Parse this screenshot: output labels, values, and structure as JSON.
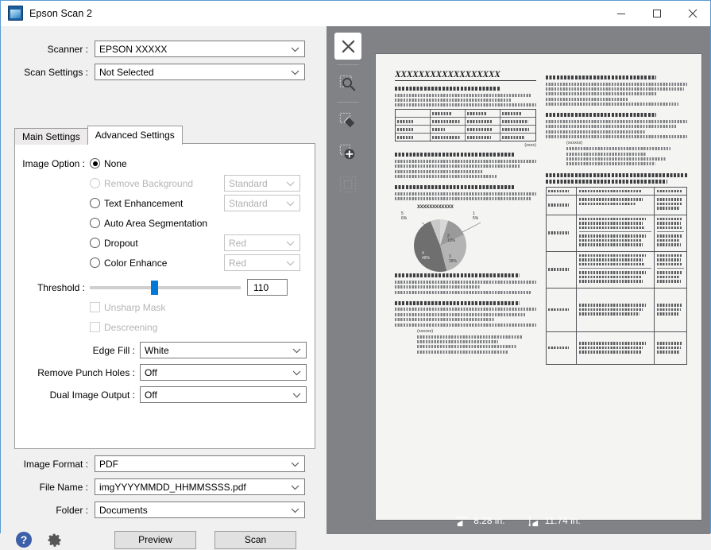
{
  "window": {
    "title": "Epson Scan 2",
    "icon": "epson-app-icon",
    "minimize_label": "Minimize",
    "maximize_label": "Maximize",
    "close_label": "Close"
  },
  "top": {
    "scanner_label": "Scanner :",
    "scanner_value": "EPSON XXXXX",
    "scan_settings_label": "Scan Settings :",
    "scan_settings_value": "Not Selected"
  },
  "tabs": [
    {
      "label": "Main Settings",
      "active": false
    },
    {
      "label": "Advanced Settings",
      "active": true
    }
  ],
  "advanced": {
    "image_option_label": "Image Option :",
    "options": [
      {
        "label": "None",
        "selected": true,
        "disabled": false,
        "combo": null
      },
      {
        "label": "Remove Background",
        "selected": false,
        "disabled": true,
        "combo": "Standard"
      },
      {
        "label": "Text Enhancement",
        "selected": false,
        "disabled": false,
        "combo": "Standard"
      },
      {
        "label": "Auto Area Segmentation",
        "selected": false,
        "disabled": false,
        "combo": null
      },
      {
        "label": "Dropout",
        "selected": false,
        "disabled": false,
        "combo": "Red"
      },
      {
        "label": "Color Enhance",
        "selected": false,
        "disabled": false,
        "combo": "Red"
      }
    ],
    "threshold_label": "Threshold :",
    "threshold_value": "110",
    "threshold_percent": 43,
    "checkboxes": [
      {
        "label": "Unsharp Mask",
        "checked": false,
        "disabled": true
      },
      {
        "label": "Descreening",
        "checked": false,
        "disabled": true
      }
    ],
    "selects": [
      {
        "label": "Edge Fill :",
        "value": "White"
      },
      {
        "label": "Remove Punch Holes :",
        "value": "Off"
      },
      {
        "label": "Dual Image Output :",
        "value": "Off"
      }
    ]
  },
  "bottom": {
    "image_format_label": "Image Format :",
    "image_format_value": "PDF",
    "file_name_label": "File Name :",
    "file_name_value": "imgYYYYMMDD_HHMMSSSS.pdf",
    "folder_label": "Folder :",
    "folder_value": "Documents",
    "help_icon": "help-icon",
    "settings_icon": "gear-icon",
    "preview_button": "Preview",
    "scan_button": "Scan"
  },
  "preview": {
    "tools": [
      {
        "name": "close-preview-icon",
        "active": true,
        "disabled": false
      },
      {
        "name": "zoom-icon",
        "active": false,
        "disabled": false
      },
      {
        "name": "rotate-icon",
        "active": false,
        "disabled": false
      },
      {
        "name": "add-frame-icon",
        "active": false,
        "disabled": false
      },
      {
        "name": "all-frames-icon",
        "active": false,
        "disabled": true
      }
    ],
    "document": {
      "title": "XXXXXXXXXXXXXXXXXX",
      "left_blocks": [
        {
          "head": "XXXXXXXXXXXXXXXXX",
          "lines": [
            96,
            82,
            100
          ]
        },
        {
          "head": "XXXXXXXXXXXXXXXXXXXXXX",
          "lines": [
            100,
            88,
            62,
            72
          ]
        },
        {
          "head": "XXXXXXXXXXXXXXXXXXXXXX",
          "lines": [
            100,
            96,
            52
          ]
        }
      ],
      "mini_table": {
        "columns": [
          "",
          "XXXX",
          "XXXX",
          "XXXX"
        ],
        "rows": [
          [
            "XXX",
            "XXXXXXX",
            "XXXXXX",
            "XXXXXX"
          ],
          [
            "XXX",
            "XXXX",
            "XXXXXXX",
            "XXXXXXX"
          ],
          [
            "XXX",
            "XXXXXXX",
            "XXXXXX",
            "XXXXX"
          ]
        ],
        "caption": "(xxxx)"
      },
      "lower_left_blocks": [
        {
          "head": "XXXXXXXXXXXXXXXXXXXXXX",
          "lines": [
            100,
            60,
            96
          ]
        },
        {
          "head": "XXXXXXXXXXXXXXXXXXXXXX",
          "lines": [
            100,
            92,
            70,
            100
          ]
        }
      ],
      "numbered_caption": "(xxxxxx)",
      "numbered_items": [
        "1",
        "2",
        "3",
        "4"
      ],
      "right_blocks": [
        {
          "head": "XXXXXXXXXXXXXXXXXXXXXX",
          "lines": [
            100,
            98,
            78,
            58,
            94
          ]
        },
        {
          "head": "XXXXXXXXXXXXXXXXXXXXXX",
          "lines": [
            100,
            92,
            70,
            100
          ]
        }
      ],
      "right_table_title": "XXXXXXXXXXXXXXXXXXXXXXXXXXX",
      "big_table": {
        "header": [
          "XXXXX",
          "XXXXXXXXXXXX",
          "XXXXXXXXXXXXXXXX"
        ],
        "rows": [
          {
            "label": "XXXXX",
            "sub": 1
          },
          {
            "label": "XXXXX",
            "sub": 2
          },
          {
            "label": "XXXXX",
            "sub": 2
          },
          {
            "label": "XXXXX",
            "sub": 1
          },
          {
            "label": "XXXXX",
            "sub": 1
          }
        ]
      }
    },
    "chart_data": {
      "type": "pie",
      "title": "XXXXXXXXXXXX",
      "categories": [
        "1",
        "2",
        "3",
        "4",
        "5"
      ],
      "values": [
        5,
        13,
        28,
        48,
        6
      ],
      "labels": [
        "5%",
        "13%",
        "28%",
        "48%",
        "6%"
      ],
      "colors": [
        "#d8d8d8",
        "#9a9a9a",
        "#b4b4b4",
        "#6f6f6f",
        "#c9c9c9"
      ],
      "legend": "none"
    }
  },
  "status": {
    "width_icon": "width-icon",
    "width_value": "8.28 in.",
    "height_icon": "height-icon",
    "height_value": "11.74 in."
  },
  "colors": {
    "accent": "#0078d7",
    "preview_bg": "#808285",
    "page_bg": "#f4f4f2",
    "window_border": "#5b9bd5"
  }
}
